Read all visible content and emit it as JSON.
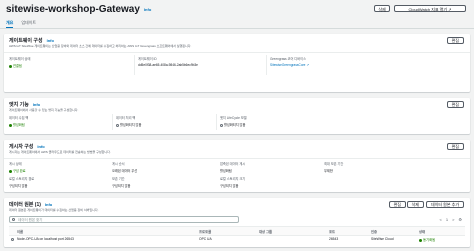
{
  "header": {
    "title": "sitewise-workshop-Gateway",
    "info": "Info",
    "delete_label": "삭제",
    "cloudwatch_label": "CloudWatch 지표 열기"
  },
  "tabs": [
    "개요",
    "업데이트"
  ],
  "gateway_config": {
    "heading": "게이트웨이 구성",
    "info": "Info",
    "desc": "AWS IoT SiteWise 게이트웨이는 산업용 장비와 데이터 소스 간에 데이터를 수집하고 처리하는 AWS IoT Greengrass 소프트웨어에서 실행됩니다.",
    "edit_label": "편집",
    "fields": [
      {
        "label": "게이트웨이 상태",
        "value": "연결됨"
      },
      {
        "label": "게이트웨이 ID",
        "value": "dd5e0f38-ae65-408a-9846-2ab5b6ec9b3e"
      },
      {
        "label": "Greengrass 코어 디바이스",
        "value": "SitewiseGreengrassCore"
      }
    ]
  },
  "edge_capability": {
    "heading": "엣지 기능",
    "info": "Info",
    "desc": "게이트웨이에서 사용할 수 있는 엣지 기능을 구성합니다.",
    "edit_label": "편집",
    "fields": [
      {
        "label": "데이터 수집 팩",
        "value": "활성화됨"
      },
      {
        "label": "데이터 처리 팩",
        "value": "활성화되지 않음"
      },
      {
        "label": "엣지 LifeCycle 모델",
        "value": "활성화되지 않음"
      }
    ]
  },
  "publisher_config": {
    "heading": "게시자 구성",
    "info": "Info",
    "desc": "게시자는 게이트웨이에서 AWS 클라우드로 데이터를 전송하는 방법을 구성합니다.",
    "edit_label": "편집",
    "row1": [
      {
        "label": "게시 상태",
        "value": "구성 완료"
      },
      {
        "label": "게시 순서",
        "value": "오래된 데이터 우선"
      },
      {
        "label": "압축된 데이터 게시",
        "value": "활성화됨"
      },
      {
        "label": "최대 보존 기간",
        "value": "무제한"
      }
    ],
    "row2": [
      {
        "label": "로컬 스토리지 경로",
        "value": "구성되지 않음"
      },
      {
        "label": "보존 기간",
        "value": "구성되지 않음"
      },
      {
        "label": "로컬 스토리지 크기",
        "value": "구성되지 않음"
      },
      {
        "label": "",
        "value": ""
      }
    ]
  },
  "data_sources": {
    "heading": "데이터 원본 (1)",
    "info": "Info",
    "desc": "데이터 원본은 게이트웨이가 데이터를 수집하는 산업용 장비 서버입니다.",
    "buttons": [
      "편집",
      "삭제",
      "데이터 원본 추가"
    ],
    "search_placeholder": "데이터 원본 찾기",
    "pager": {
      "prev": "<",
      "page": "1",
      "next": ">"
    },
    "columns": [
      "이름",
      "프로토콜",
      "대상 그룹",
      "포트",
      "인증",
      "상태"
    ],
    "rows": [
      {
        "name": "Node-OPC-UA on localhost port 26543",
        "protocol": "OPC UA",
        "target": "",
        "port": "26543",
        "auth": "SiteWise Cloud",
        "status": "동기화됨"
      }
    ]
  },
  "colors": {
    "accent": "#0073bb",
    "success": "#1d8102",
    "background": "#f2f3f3"
  }
}
